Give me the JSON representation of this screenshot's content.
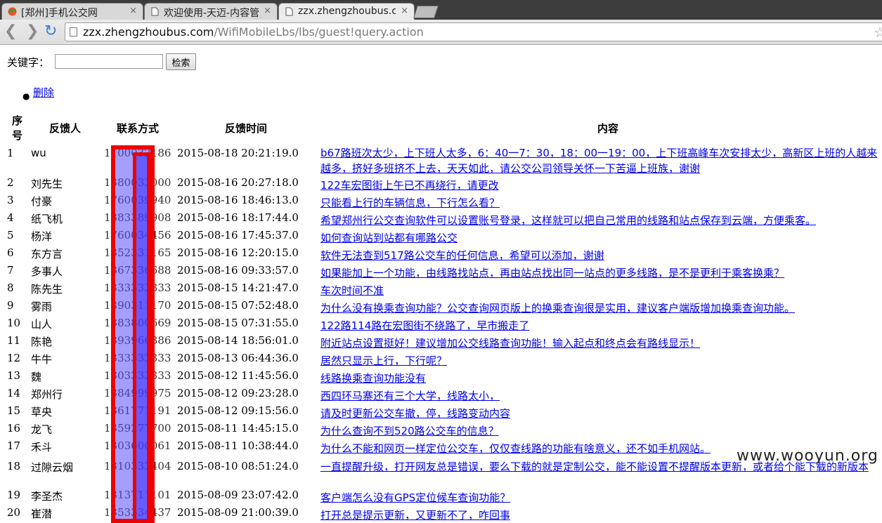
{
  "browser": {
    "tabs": [
      {
        "title": "[郑州]手机公交网",
        "close": "×"
      },
      {
        "title": "欢迎使用-天迈-内容管",
        "close": "×"
      },
      {
        "title": "zzx.zhengzhoubus.c",
        "close": "×"
      }
    ],
    "url_host": "zzx.zhengzhoubus.com",
    "url_path": "/WifiMobileLbs/lbs/guest!query.action"
  },
  "search": {
    "label": "关键字：",
    "value": "",
    "button": "检索"
  },
  "actions": {
    "delete": "删除"
  },
  "table": {
    "headers": {
      "index_line1": "序",
      "index_line2": "号",
      "name": "反馈人",
      "contact": "联系方式",
      "time": "反馈时间",
      "content": "内容"
    },
    "rows": [
      {
        "index": "1",
        "name": "wu",
        "contact": "1100032186",
        "time": "2015-08-18 20:21:19.0",
        "content": "b67路班次太少，上下班人太多，6：40一7：30，18：00一19：00，上下班高峰车次安排太少，高新区上班的人越来越多，挤好多班挤不上去，天天如此，请公交公司领导关怀一下苦逼上班族，谢谢"
      },
      {
        "index": "2",
        "name": "刘先生",
        "contact": "1380033000",
        "time": "2015-08-16 20:27:18.0",
        "content": "122车宏图街上午已不再绕行，请更改"
      },
      {
        "index": "3",
        "name": "付豪",
        "contact": "1760039940",
        "time": "2015-08-16 18:46:13.0",
        "content": "只能看上行的车辆信息，下行怎么看？"
      },
      {
        "index": "4",
        "name": "纸飞机",
        "contact": "1383389908",
        "time": "2015-08-16 18:17:44.0",
        "content": "希望郑州行公交查询软件可以设置账号登录，这样就可以把自己常用的线路和站点保存到云端，方便乘客。"
      },
      {
        "index": "5",
        "name": "杨洋",
        "contact": "1760034456",
        "time": "2015-08-16 17:45:37.0",
        "content": "如何查询站到站都有哪路公交"
      },
      {
        "index": "6",
        "name": "东方言",
        "contact": "1352331165",
        "time": "2015-08-16 12:20:15.0",
        "content": "软件无法查到517路公交车的任何信息，希望可以添加，谢谢"
      },
      {
        "index": "7",
        "name": "多事人",
        "contact": "1367336688",
        "time": "2015-08-16 09:33:57.0",
        "content": "如果能加上一个功能，由线路找站点，再由站点找出同一站点的更多线路，是不是更利于乘客换乘？"
      },
      {
        "index": "8",
        "name": "陈先生",
        "contact": "1333333333",
        "time": "2015-08-15 14:21:47.0",
        "content": "车次时间不准"
      },
      {
        "index": "9",
        "name": "雾雨",
        "contact": "1390311170",
        "time": "2015-08-15 07:52:48.0",
        "content": "为什么没有换乘查询功能？公交查询网页版上的换乘查询很是实用，建议客户端版增加换乘查询功能。"
      },
      {
        "index": "10",
        "name": "山人",
        "contact": "1383800669",
        "time": "2015-08-15 07:31:55.0",
        "content": "122路114路在宏图街不绕路了，早市搬走了"
      },
      {
        "index": "11",
        "name": "陈艳",
        "contact": "1393966386",
        "time": "2015-08-14 18:56:01.0",
        "content": "附近站点设置挺好！建议增加公交线路查询功能！输入起点和终点会有路线显示！"
      },
      {
        "index": "12",
        "name": "牛牛",
        "contact": "1333333333",
        "time": "2015-08-13 06:44:36.0",
        "content": "居然只显示上行，下行呢？"
      },
      {
        "index": "13",
        "name": "魏",
        "contact": "1303333333",
        "time": "2015-08-12 11:45:56.0",
        "content": "线路换乘查询功能没有"
      },
      {
        "index": "14",
        "name": "郑州行",
        "contact": "1384999975",
        "time": "2015-08-12 09:23:28.0",
        "content": "西四环马寨还有三个大学，线路太小，"
      },
      {
        "index": "15",
        "name": "草央",
        "contact": "1361771191",
        "time": "2015-08-12 09:15:56.0",
        "content": "请及时更新公交车撤，停，线路变动内容"
      },
      {
        "index": "16",
        "name": "龙飞",
        "contact": "1359277700",
        "time": "2015-08-11 14:45:15.0",
        "content": "为什么查询不到520路公交车的信息？"
      },
      {
        "index": "17",
        "name": "禾斗",
        "contact": "1303600061",
        "time": "2015-08-11 10:38:44.0",
        "content": "为什么不能和网页一样定位公交车，仅仅查线路的功能有啥意义，还不如手机网站。"
      },
      {
        "index": "18",
        "name": "过隙云烟",
        "contact": "1310333404",
        "time": "2015-08-10 08:51:24.0",
        "content": "一直提醒升级，打开网友总是错误，要么下载的就是定制公交，能不能设置不提醒版本更新，或者给个能下载的新版本"
      },
      {
        "index": "19",
        "name": "李圣杰",
        "contact": "1313711101",
        "time": "2015-08-09 23:07:42.0",
        "content": "客户端怎么没有GPS定位候车查询功能？"
      },
      {
        "index": "20",
        "name": "崔潜",
        "contact": "1353334437",
        "time": "2015-08-09 21:00:39.0",
        "content": "打开总是提示更新，又更新不了，咋回事"
      }
    ]
  },
  "watermark": "www.wooyun.org"
}
